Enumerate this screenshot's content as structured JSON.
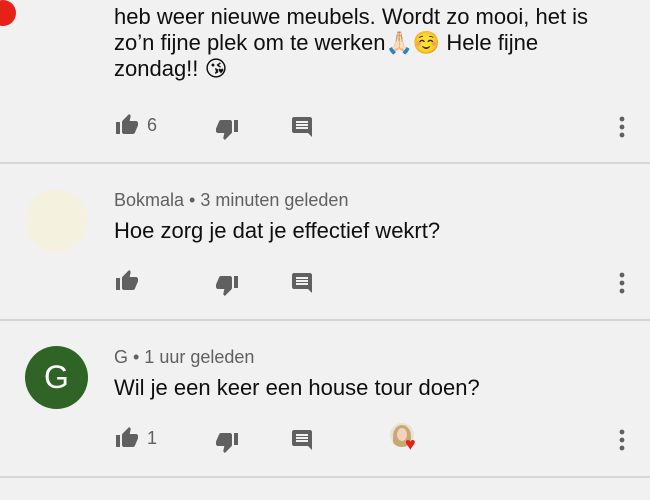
{
  "comments": [
    {
      "author": "",
      "time": "",
      "text_lines": [
        "heb weer nieuwe meubels. Wordt zo mooi, het is",
        "zo’n fijne plek om te werken🙏🏻☺️ Hele fijne",
        "zondag!! 😘"
      ],
      "likes": "6"
    },
    {
      "author_meta": "Bokmala • 3 minuten geleden",
      "text": "Hoe zorg je dat je effectief wekrt?",
      "likes": ""
    },
    {
      "author_meta": "G • 1 uur geleden",
      "avatar_letter": "G",
      "text": "Wil je een keer een house tour doen?",
      "likes": "1",
      "creator_heart": true
    }
  ],
  "colors": {
    "background": "#f1f1f1",
    "divider": "#d6d6d6",
    "avatar_green": "#2f6426",
    "avatar_beige": "#f4f1df",
    "heart_red": "#e62117",
    "meta_gray": "#606060"
  },
  "icons": [
    "thumbs-up-icon",
    "thumbs-down-icon",
    "reply-icon",
    "more-vert-icon",
    "heart-icon"
  ]
}
